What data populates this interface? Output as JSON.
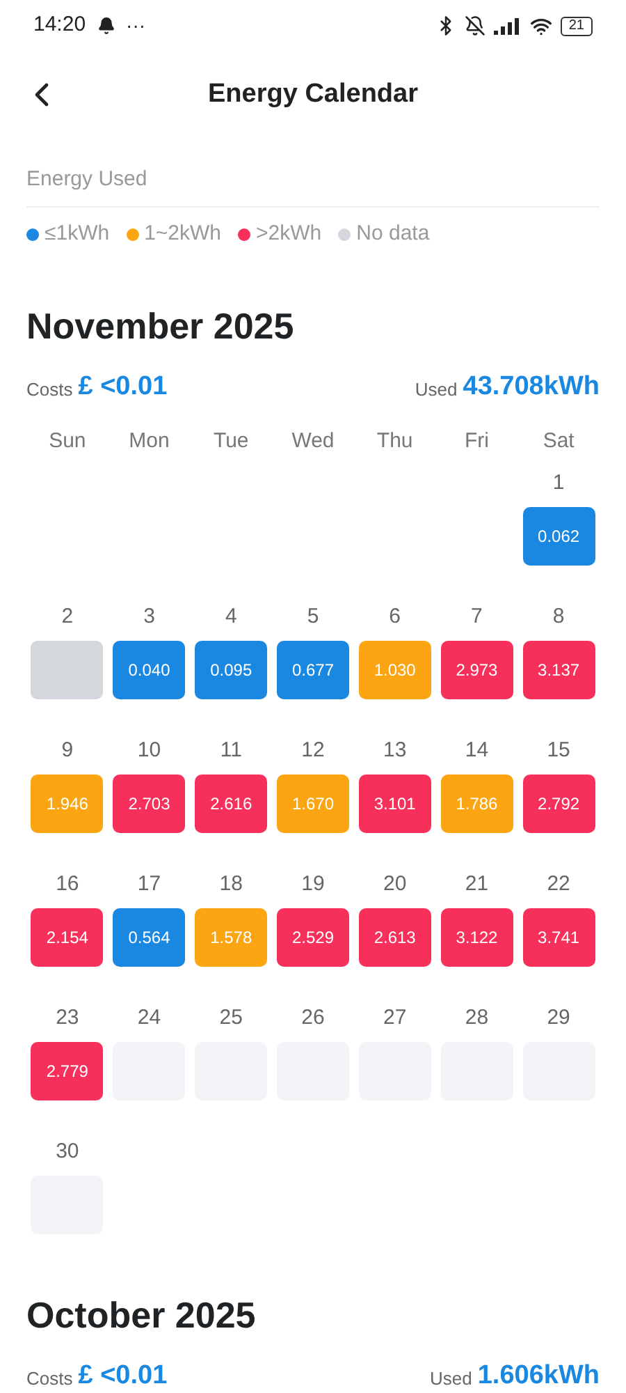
{
  "status_bar": {
    "time": "14:20",
    "more": "···",
    "battery": "21"
  },
  "header": {
    "title": "Energy Calendar"
  },
  "legend": {
    "title": "Energy Used",
    "items": [
      {
        "label": "≤1kWh",
        "color": "#1a88e0"
      },
      {
        "label": "1~2kWh",
        "color": "#fba512"
      },
      {
        "label": ">2kWh",
        "color": "#f6305a"
      },
      {
        "label": "No data",
        "color": "#d4d7dc"
      }
    ]
  },
  "months": [
    {
      "title": "November 2025",
      "costs_label": "Costs",
      "costs": "£ <0.01",
      "used_label": "Used",
      "used": "43.708kWh",
      "weekdays": [
        "Sun",
        "Mon",
        "Tue",
        "Wed",
        "Thu",
        "Fri",
        "Sat"
      ],
      "weeks": [
        [
          {
            "kind": "blank"
          },
          {
            "kind": "blank"
          },
          {
            "kind": "blank"
          },
          {
            "kind": "blank"
          },
          {
            "kind": "blank"
          },
          {
            "kind": "blank"
          },
          {
            "kind": "low",
            "day": "1",
            "value": "0.062"
          }
        ],
        [
          {
            "kind": "nodata",
            "day": "2"
          },
          {
            "kind": "low",
            "day": "3",
            "value": "0.040"
          },
          {
            "kind": "low",
            "day": "4",
            "value": "0.095"
          },
          {
            "kind": "low",
            "day": "5",
            "value": "0.677"
          },
          {
            "kind": "mid",
            "day": "6",
            "value": "1.030"
          },
          {
            "kind": "high",
            "day": "7",
            "value": "2.973"
          },
          {
            "kind": "high",
            "day": "8",
            "value": "3.137"
          }
        ],
        [
          {
            "kind": "mid",
            "day": "9",
            "value": "1.946"
          },
          {
            "kind": "high",
            "day": "10",
            "value": "2.703"
          },
          {
            "kind": "high",
            "day": "11",
            "value": "2.616"
          },
          {
            "kind": "mid",
            "day": "12",
            "value": "1.670"
          },
          {
            "kind": "high",
            "day": "13",
            "value": "3.101"
          },
          {
            "kind": "mid",
            "day": "14",
            "value": "1.786"
          },
          {
            "kind": "high",
            "day": "15",
            "value": "2.792"
          }
        ],
        [
          {
            "kind": "high",
            "day": "16",
            "value": "2.154"
          },
          {
            "kind": "low",
            "day": "17",
            "value": "0.564"
          },
          {
            "kind": "mid",
            "day": "18",
            "value": "1.578"
          },
          {
            "kind": "high",
            "day": "19",
            "value": "2.529"
          },
          {
            "kind": "high",
            "day": "20",
            "value": "2.613"
          },
          {
            "kind": "high",
            "day": "21",
            "value": "3.122"
          },
          {
            "kind": "high",
            "day": "22",
            "value": "3.741"
          }
        ],
        [
          {
            "kind": "high",
            "day": "23",
            "value": "2.779"
          },
          {
            "kind": "future",
            "day": "24"
          },
          {
            "kind": "future",
            "day": "25"
          },
          {
            "kind": "future",
            "day": "26"
          },
          {
            "kind": "future",
            "day": "27"
          },
          {
            "kind": "future",
            "day": "28"
          },
          {
            "kind": "future",
            "day": "29"
          }
        ],
        [
          {
            "kind": "future",
            "day": "30"
          }
        ]
      ]
    },
    {
      "title": "October 2025",
      "costs_label": "Costs",
      "costs": "£ <0.01",
      "used_label": "Used",
      "used": "1.606kWh"
    }
  ]
}
